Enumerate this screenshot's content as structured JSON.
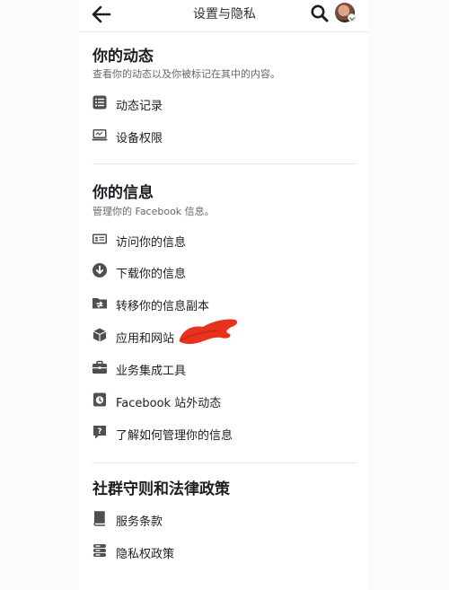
{
  "header": {
    "title": "设置与隐私"
  },
  "sections": [
    {
      "title": "你的动态",
      "description": "查看你的动态以及你被标记在其中的内容。",
      "items": [
        {
          "label": "动态记录",
          "icon": "list-icon"
        },
        {
          "label": "设备权限",
          "icon": "device-permissions-icon"
        }
      ]
    },
    {
      "title": "你的信息",
      "description": "管理你的 Facebook 信息。",
      "items": [
        {
          "label": "访问你的信息",
          "icon": "id-card-icon"
        },
        {
          "label": "下载你的信息",
          "icon": "download-icon"
        },
        {
          "label": "转移你的信息副本",
          "icon": "folder-transfer-icon"
        },
        {
          "label": "应用和网站",
          "icon": "cube-icon"
        },
        {
          "label": "业务集成工具",
          "icon": "briefcase-icon"
        },
        {
          "label": "Facebook 站外动态",
          "icon": "activity-history-icon"
        },
        {
          "label": "了解如何管理你的信息",
          "icon": "help-chat-icon"
        }
      ]
    },
    {
      "title": "社群守则和法律政策",
      "items": [
        {
          "label": "服务条款",
          "icon": "book-icon"
        },
        {
          "label": "隐私权政策",
          "icon": "privacy-policy-icon"
        }
      ]
    }
  ],
  "colors": {
    "text": "#1c1e21",
    "secondary_text": "#65676b",
    "icon": "#4b4f56",
    "divider": "#e4e6eb",
    "scribble": "#e8321e"
  }
}
